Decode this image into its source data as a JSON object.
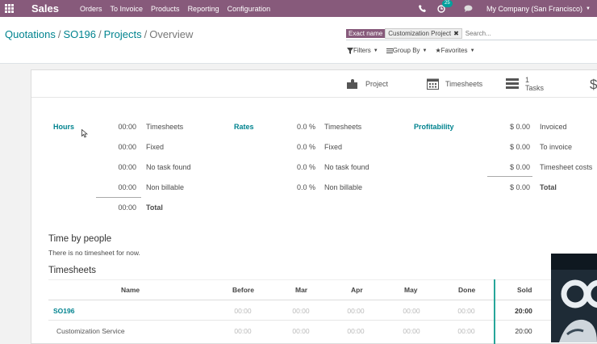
{
  "navbar": {
    "app_name": "Sales",
    "menus": [
      "Orders",
      "To Invoice",
      "Products",
      "Reporting",
      "Configuration"
    ],
    "activity_count": "25",
    "company": "My Company (San Francisco)"
  },
  "breadcrumb": {
    "items": [
      "Quotations",
      "SO196",
      "Projects"
    ],
    "current": "Overview"
  },
  "search": {
    "facet_label": "Exact name",
    "facet_value": "Customization Project",
    "placeholder": "Search..."
  },
  "filters": {
    "filters": "Filters",
    "group_by": "Group By",
    "favorites": "Favorites"
  },
  "stat_buttons": {
    "project": "Project",
    "timesheets": "Timesheets",
    "tasks_count": "1",
    "tasks_label": "Tasks",
    "currency_symbol": "$"
  },
  "hours": {
    "title": "Hours",
    "rows": [
      {
        "value": "00:00",
        "label": "Timesheets"
      },
      {
        "value": "00:00",
        "label": "Fixed"
      },
      {
        "value": "00:00",
        "label": "No task found"
      },
      {
        "value": "00:00",
        "label": "Non billable"
      },
      {
        "value": "00:00",
        "label": "Total"
      }
    ]
  },
  "rates": {
    "title": "Rates",
    "rows": [
      {
        "value": "0.0 %",
        "label": "Timesheets"
      },
      {
        "value": "0.0 %",
        "label": "Fixed"
      },
      {
        "value": "0.0 %",
        "label": "No task found"
      },
      {
        "value": "0.0 %",
        "label": "Non billable"
      }
    ]
  },
  "profitability": {
    "title": "Profitability",
    "rows": [
      {
        "value": "$ 0.00",
        "label": "Invoiced"
      },
      {
        "value": "$ 0.00",
        "label": "To invoice"
      },
      {
        "value": "$ 0.00",
        "label": "Timesheet costs"
      },
      {
        "value": "$ 0.00",
        "label": "Total"
      }
    ]
  },
  "time_by_people": {
    "title": "Time by people",
    "empty": "There is no timesheet for now."
  },
  "timesheets_table": {
    "title": "Timesheets",
    "headers": [
      "Name",
      "Before",
      "Mar",
      "Apr",
      "May",
      "Done",
      "Sold"
    ],
    "rows": [
      {
        "name": "SO196",
        "before": "00:00",
        "mar": "00:00",
        "apr": "00:00",
        "may": "00:00",
        "done": "00:00",
        "sold": "20:00"
      },
      {
        "name": "Customization Service",
        "before": "00:00",
        "mar": "00:00",
        "apr": "00:00",
        "may": "00:00",
        "done": "00:00",
        "sold": "20:00"
      }
    ]
  },
  "colors": {
    "navbar": "#875a7b",
    "link": "#00838f",
    "divider_accent": "#26a69a"
  }
}
